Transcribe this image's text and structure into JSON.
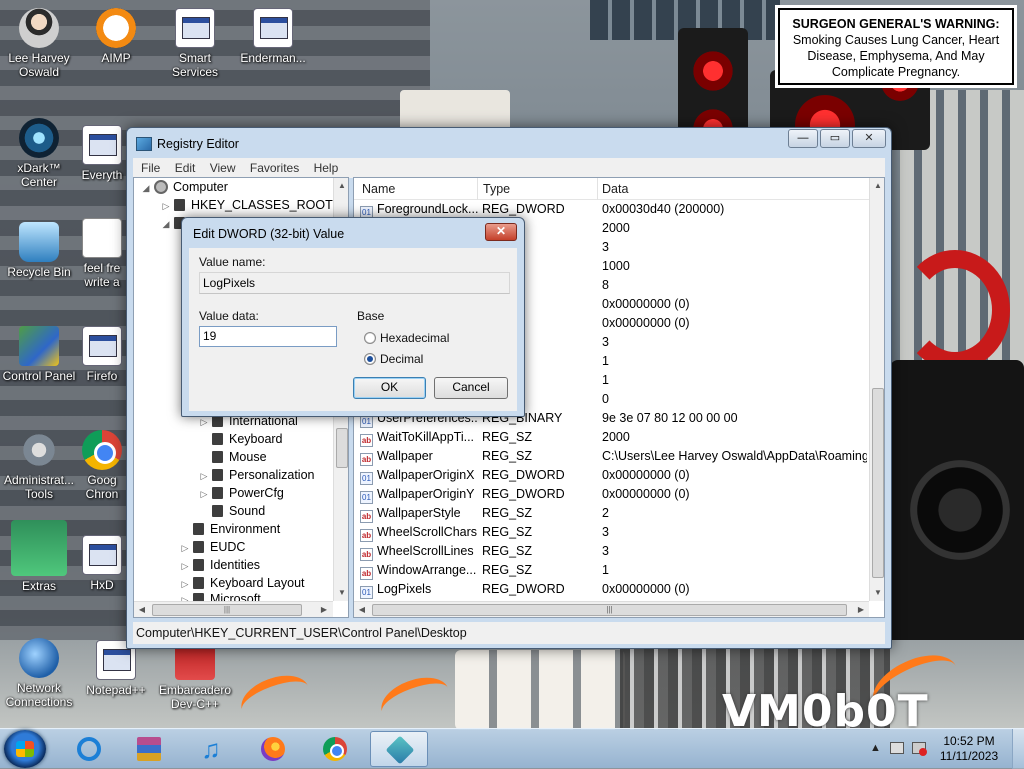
{
  "warning": {
    "heading": "SURGEON GENERAL'S WARNING:",
    "text": "Smoking Causes Lung Cancer, Heart Disease, Emphysema, And May Complicate Pregnancy."
  },
  "wallpaper_logo": "VM0b0T",
  "desktop_icons": [
    {
      "label": "Lee Harvey\nOswald",
      "icon": "person-icon"
    },
    {
      "label": "AIMP",
      "icon": "aimp-icon"
    },
    {
      "label": "Smart\nServices",
      "icon": "services-icon"
    },
    {
      "label": "Enderman...",
      "icon": "app-icon"
    },
    {
      "label": "xDark™\nCenter",
      "icon": "xdark-icon"
    },
    {
      "label": "Everyth",
      "icon": "app-icon"
    },
    {
      "label": "Recycle Bin",
      "icon": "recycle-bin-icon"
    },
    {
      "label": "feel fre\nwrite a",
      "icon": "document-icon"
    },
    {
      "label": "Control Panel",
      "icon": "control-panel-icon"
    },
    {
      "label": "Firefo",
      "icon": "app-icon"
    },
    {
      "label": "Administrat...\nTools",
      "icon": "admin-tools-icon"
    },
    {
      "label": "Goog\nChron",
      "icon": "chrome-icon"
    },
    {
      "label": "Extras",
      "icon": "extras-icon"
    },
    {
      "label": "HxD",
      "icon": "app-icon"
    },
    {
      "label": "Network\nConnections",
      "icon": "network-icon"
    },
    {
      "label": "Notepad++",
      "icon": "app-icon"
    },
    {
      "label": "Embarcadero\nDev-C++",
      "icon": "devcpp-icon"
    }
  ],
  "regedit": {
    "title": "Registry Editor",
    "buttons": {
      "minimize": "—",
      "maximize": "▭",
      "close": "✕"
    },
    "menu": [
      "File",
      "Edit",
      "View",
      "Favorites",
      "Help"
    ],
    "tree": [
      {
        "label": "Computer",
        "level": 0,
        "expander": "◢"
      },
      {
        "label": "HKEY_CLASSES_ROOT",
        "level": 1,
        "expander": "▷"
      },
      {
        "label": "International",
        "level": 3,
        "expander": "▷"
      },
      {
        "label": "Keyboard",
        "level": 3,
        "expander": ""
      },
      {
        "label": "Mouse",
        "level": 3,
        "expander": ""
      },
      {
        "label": "Personalization",
        "level": 3,
        "expander": "▷"
      },
      {
        "label": "PowerCfg",
        "level": 3,
        "expander": "▷"
      },
      {
        "label": "Sound",
        "level": 3,
        "expander": ""
      },
      {
        "label": "Environment",
        "level": 2,
        "expander": ""
      },
      {
        "label": "EUDC",
        "level": 2,
        "expander": "▷"
      },
      {
        "label": "Identities",
        "level": 2,
        "expander": "▷"
      },
      {
        "label": "Keyboard Layout",
        "level": 2,
        "expander": "▷"
      },
      {
        "label": "Microsoft",
        "level": 2,
        "expander": "▷"
      }
    ],
    "columns": {
      "name": "Name",
      "type": "Type",
      "data": "Data"
    },
    "values": [
      {
        "name": "ForegroundLock...",
        "type": "REG_DWORD",
        "data": "0x00030d40 (200000)",
        "kind": "bin"
      },
      {
        "name": "",
        "type": "",
        "data": "2000",
        "kind": ""
      },
      {
        "name": "",
        "type": "",
        "data": "3",
        "kind": ""
      },
      {
        "name": "",
        "type": "",
        "data": "1000",
        "kind": ""
      },
      {
        "name": "",
        "type": "",
        "data": "8",
        "kind": ""
      },
      {
        "name": "",
        "type": "ORD",
        "data": "0x00000000 (0)",
        "kind": ""
      },
      {
        "name": "",
        "type": "ORD",
        "data": "0x00000000 (0)",
        "kind": ""
      },
      {
        "name": "",
        "type": "",
        "data": "3",
        "kind": ""
      },
      {
        "name": "",
        "type": "",
        "data": "1",
        "kind": ""
      },
      {
        "name": "",
        "type": "",
        "data": "1",
        "kind": ""
      },
      {
        "name": "",
        "type": "",
        "data": "0",
        "kind": ""
      },
      {
        "name": "UserPreferences...",
        "type": "REG_BINARY",
        "data": "9e 3e 07 80 12 00 00 00",
        "kind": "bin"
      },
      {
        "name": "WaitToKillAppTi...",
        "type": "REG_SZ",
        "data": "2000",
        "kind": "sz"
      },
      {
        "name": "Wallpaper",
        "type": "REG_SZ",
        "data": "C:\\Users\\Lee Harvey Oswald\\AppData\\Roaming\\...",
        "kind": "sz"
      },
      {
        "name": "WallpaperOriginX",
        "type": "REG_DWORD",
        "data": "0x00000000 (0)",
        "kind": "bin"
      },
      {
        "name": "WallpaperOriginY",
        "type": "REG_DWORD",
        "data": "0x00000000 (0)",
        "kind": "bin"
      },
      {
        "name": "WallpaperStyle",
        "type": "REG_SZ",
        "data": "2",
        "kind": "sz"
      },
      {
        "name": "WheelScrollChars",
        "type": "REG_SZ",
        "data": "3",
        "kind": "sz"
      },
      {
        "name": "WheelScrollLines",
        "type": "REG_SZ",
        "data": "3",
        "kind": "sz"
      },
      {
        "name": "WindowArrange...",
        "type": "REG_SZ",
        "data": "1",
        "kind": "sz"
      },
      {
        "name": "LogPixels",
        "type": "REG_DWORD",
        "data": "0x00000000 (0)",
        "kind": "bin"
      }
    ],
    "status_path": "Computer\\HKEY_CURRENT_USER\\Control Panel\\Desktop"
  },
  "dialog": {
    "title": "Edit DWORD (32-bit) Value",
    "close": "✕",
    "value_name_label": "Value name:",
    "value_name": "LogPixels",
    "value_data_label": "Value data:",
    "value_data": "19",
    "base_label": "Base",
    "hex_label": "Hexadecimal",
    "dec_label": "Decimal",
    "selected_base": "Decimal",
    "ok": "OK",
    "cancel": "Cancel"
  },
  "taskbar": {
    "pinned": [
      "internet-explorer-icon",
      "winrar-icon",
      "music-player-icon",
      "firefox-icon",
      "chrome-icon",
      "regedit-icon"
    ],
    "time": "10:52 PM",
    "date": "11/11/2023",
    "tray_arrow": "▲"
  },
  "colors": {
    "dialog_close": "#c4402a",
    "selection_accent": "#1c4f9c"
  }
}
